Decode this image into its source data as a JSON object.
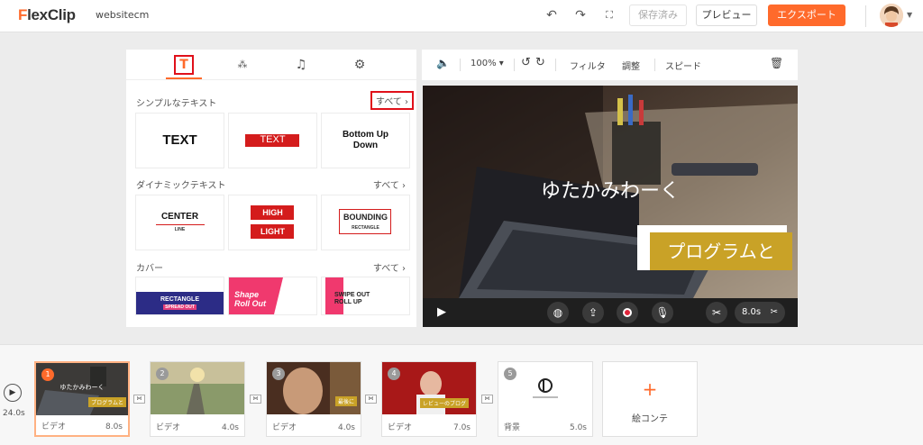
{
  "app": {
    "logo": "FlexClip",
    "project": "websitecm"
  },
  "toolbar": {
    "saved": "保存済み",
    "preview": "プレビュー",
    "export": "エクスポート"
  },
  "library": {
    "sections": [
      {
        "title": "シンプルなテキスト",
        "all": "すべて ›",
        "cards": [
          "TEXT",
          "TEXT",
          "Bottom Up Down"
        ]
      },
      {
        "title": "ダイナミックテキスト",
        "all": "すべて ›",
        "cards": [
          "CENTER",
          "HIGH",
          "LIGHT",
          "BOUNDING"
        ]
      },
      {
        "title": "カバー",
        "all": "すべて ›",
        "cards": [
          "RECTANGLE",
          "Shape Roll Out",
          "SWIPE OUT ROLL UP"
        ]
      }
    ],
    "card_sub": {
      "line": "LINE",
      "rectangle": "RECTANGLE",
      "spread_out": "SPREAD OUT"
    }
  },
  "preview_bar": {
    "zoom": "100% ▾",
    "filter": "フィルタ",
    "adjust": "調整",
    "speed": "スピード"
  },
  "canvas": {
    "title_text": "ゆたかみわーく",
    "caption": "プログラムと"
  },
  "controls": {
    "duration": "8.0s"
  },
  "timeline": {
    "total": "24.0s",
    "clips": [
      {
        "num": "1",
        "label": "ビデオ",
        "duration": "8.0s",
        "tag": "プログラムと",
        "overlay": "ゆたかみわーく"
      },
      {
        "num": "2",
        "label": "ビデオ",
        "duration": "4.0s"
      },
      {
        "num": "3",
        "label": "ビデオ",
        "duration": "4.0s",
        "tag": "最後に"
      },
      {
        "num": "4",
        "label": "ビデオ",
        "duration": "7.0s",
        "tag": "レビューのブログ"
      },
      {
        "num": "5",
        "label": "背景",
        "duration": "5.0s"
      }
    ],
    "add_label": "絵コンテ"
  },
  "colors": {
    "accent": "#ff6a2b",
    "highlight_box": "#e0101a",
    "caption_bg": "#c9a227"
  }
}
